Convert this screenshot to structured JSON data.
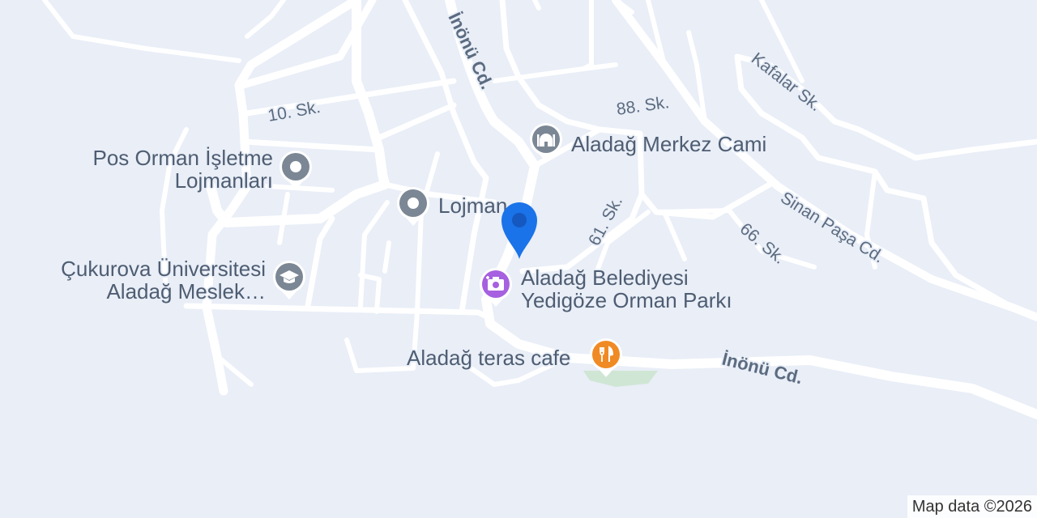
{
  "map": {
    "streets": {
      "inonu_north": "İnönü Cd.",
      "inonu_south": "İnönü Cd.",
      "sk10": "10. Sk.",
      "sk88": "88. Sk.",
      "kafalar": "Kafalar Sk.",
      "sk61": "61. Sk.",
      "sinan_pasa": "Sinan Paşa Cd.",
      "sk66": "66. Sk."
    },
    "pois": {
      "pos_orman": {
        "line1": "Pos Orman İşletme",
        "line2": "Lojmanları",
        "icon": "dot-pin-icon",
        "color": "#7b8794"
      },
      "lojman": {
        "label": "Lojman",
        "icon": "dot-pin-icon",
        "color": "#7b8794"
      },
      "mosque": {
        "label": "Aladağ Merkez Cami",
        "icon": "mosque-icon",
        "color": "#7b8794"
      },
      "university": {
        "line1": "Çukurova Üniversitesi",
        "line2": "Aladağ Meslek…",
        "icon": "graduation-cap-icon",
        "color": "#7b8794"
      },
      "park": {
        "line1": "Aladağ Belediyesi",
        "line2": "Yedigöze Orman Parkı",
        "icon": "camera-icon",
        "color": "#a660e0"
      },
      "cafe": {
        "label": "Aladağ teras cafe",
        "icon": "fork-knife-icon",
        "color": "#f08a24"
      }
    },
    "location_marker": {
      "icon": "location-pin-icon",
      "color": "#1a73e8"
    },
    "attribution": "Map data ©2026"
  }
}
